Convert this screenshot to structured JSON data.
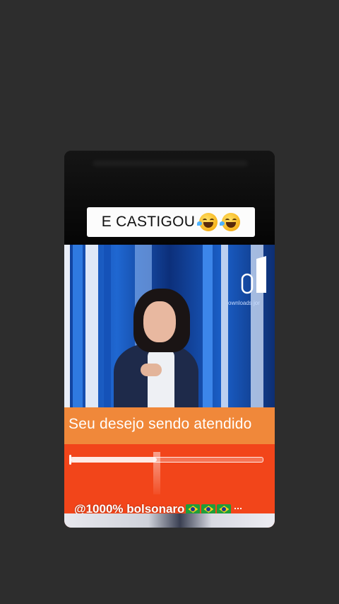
{
  "caption": {
    "text": "E CASTIGOU",
    "emojis": [
      "rofl-emoji",
      "rofl-emoji"
    ]
  },
  "scene": {
    "background_text": "ownloads jor"
  },
  "overlay": {
    "headline": "Seu desejo sendo atendido",
    "progress_fraction": 0.45,
    "watermark": "@1000% bolsonaro",
    "flag_count": 3
  },
  "colors": {
    "page_bg": "#2d2d2d",
    "orange_band": "#f0883a",
    "red_band": "#f2451a",
    "studio_blue": "#1f67d1"
  }
}
